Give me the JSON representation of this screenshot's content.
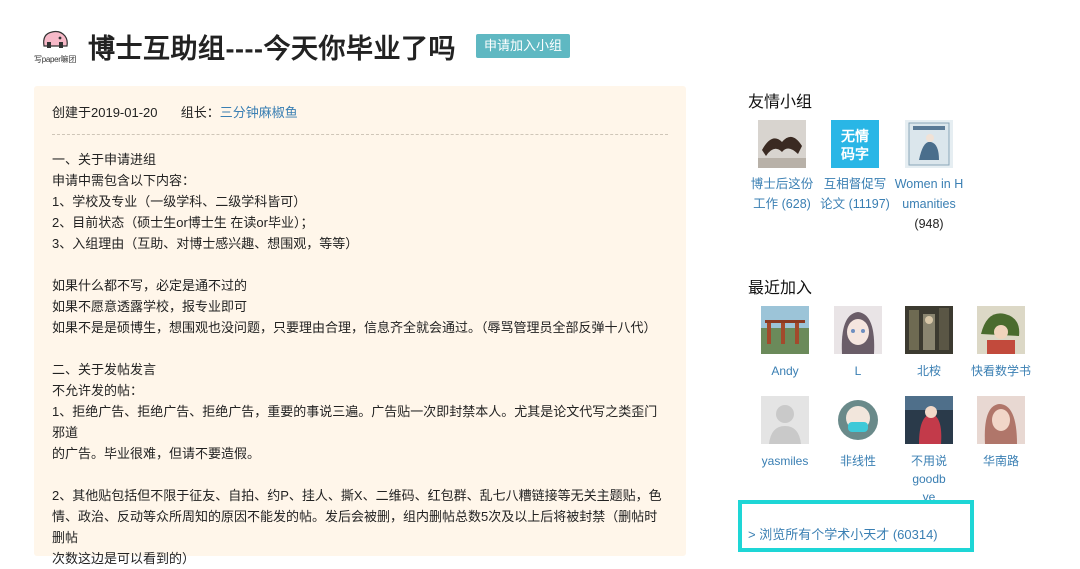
{
  "header": {
    "logo_text": "写paper嘛团",
    "title": "博士互助组----今天你毕业了吗",
    "join_button": "申请加入小组"
  },
  "info": {
    "created": "创建于2019-01-20",
    "leader_label": "组长：",
    "leader_name": "三分钟麻椒鱼",
    "lines": [
      "一、关于申请进组",
      "申请中需包含以下内容：",
      "1、学校及专业（一级学科、二级学科皆可）",
      "2、目前状态（硕士生or博士生 在读or毕业）；",
      "3、入组理由（互助、对博士感兴趣、想围观，等等）",
      "",
      "如果什么都不写，必定是通不过的",
      "如果不愿意透露学校，报专业即可",
      "如果不是是硕博生，想围观也没问题，只要理由合理，信息齐全就会通过。（辱骂管理员全部反弹十八代）",
      "",
      "二、关于发帖发言",
      "不允许发的帖：",
      "1、拒绝广告、拒绝广告、拒绝广告，重要的事说三遍。广告贴一次即封禁本人。尤其是论文代写之类歪门邪道",
      "的广告。毕业很难，但请不要造假。",
      "",
      "2、其他贴包括但不限于征友、自拍、约P、挂人、撕X、二维码、红包群、乱七八糟链接等无关主题贴，色",
      "情、政治、反动等众所周知的原因不能发的帖。发后会被删，组内删帖总数5次及以上后将被封禁（删帖时删帖",
      "次数这边是可以看到的）"
    ]
  },
  "sidebar": {
    "friends_heading": "友情小组",
    "friend_groups": [
      {
        "line1": "博士后这份",
        "line2": "工作 (628)",
        "line3": "",
        "icon": "bat-photo"
      },
      {
        "line1": "互相督促写",
        "line2": "论文 (11197)",
        "line3": "",
        "icon": "no-emotion-coding-logo",
        "logo_text1": "无情",
        "logo_text2": "码字"
      },
      {
        "line1": "Women in H",
        "line2": "umanities",
        "line3": "(948)",
        "icon": "book-cover-women"
      }
    ],
    "recent_heading": "最近加入",
    "members": [
      {
        "name": "Andy",
        "icon": "avatar-andy"
      },
      {
        "name": "L",
        "icon": "avatar-l"
      },
      {
        "name": "北桉",
        "icon": "avatar-beian"
      },
      {
        "name": "快看数学书",
        "icon": "avatar-math"
      },
      {
        "name": "yasmiles",
        "icon": "avatar-default"
      },
      {
        "name": "非线性",
        "icon": "avatar-masked"
      },
      {
        "name": "不用说goodb",
        "name2": "ye",
        "icon": "avatar-goodbye"
      },
      {
        "name": "华南路",
        "icon": "avatar-huananlu"
      }
    ],
    "browse_link": "> 浏览所有个学术小天才 (60314)"
  },
  "colors": {
    "accent": "#5fb8c2",
    "link": "#3a7fb3",
    "panel_bg": "#fff6ea",
    "highlight": "#1ed6d6"
  }
}
